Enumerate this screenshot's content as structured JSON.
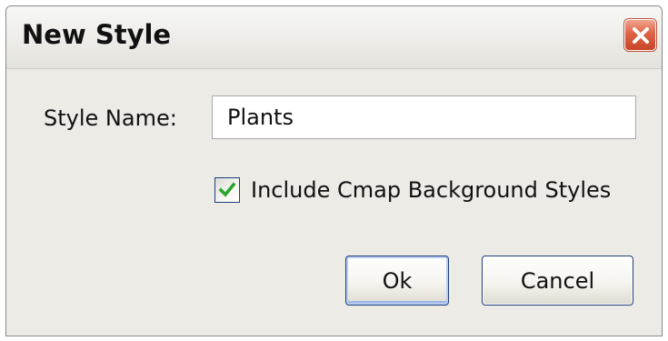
{
  "window": {
    "title": "New Style",
    "close_icon": "close-icon"
  },
  "form": {
    "style_name_label": "Style Name:",
    "style_name_value": "Plants",
    "include_background_label": "Include Cmap Background Styles",
    "include_background_checked": true
  },
  "buttons": {
    "ok_label": "Ok",
    "cancel_label": "Cancel"
  },
  "colors": {
    "close_button": "#dd6445",
    "checkmark": "#2aa52a",
    "focus_border": "#1f3f7a"
  }
}
